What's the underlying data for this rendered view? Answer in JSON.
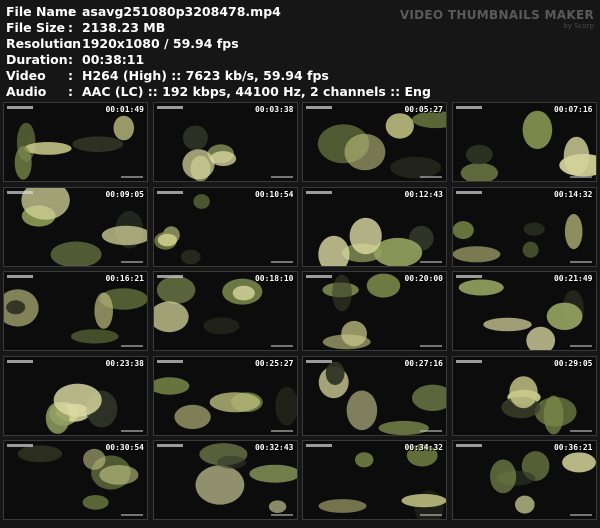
{
  "file_info": [
    {
      "label": "File Name",
      "value": "asavg251080p3208478.mp4"
    },
    {
      "label": "File Size",
      "value": "2138.23 MB"
    },
    {
      "label": "Resolution",
      "value": "1920x1080 / 59.94 fps"
    },
    {
      "label": "Duration",
      "value": "00:38:11"
    },
    {
      "label": "Video",
      "value": "H264 (High) :: 7623 kb/s, 59.94 fps"
    },
    {
      "label": "Audio",
      "value": "AAC (LC) :: 192 kbps, 44100 Hz, 2 channels :: Eng"
    }
  ],
  "separator": ":",
  "brand": {
    "title": "VIDEO THUMBNAILS MAKER",
    "subtitle": "by Scorp"
  },
  "thumbnails": [
    "00:01:49",
    "00:03:38",
    "00:05:27",
    "00:07:16",
    "00:09:05",
    "00:10:54",
    "00:12:43",
    "00:14:32",
    "00:16:21",
    "00:18:10",
    "00:20:00",
    "00:21:49",
    "00:23:38",
    "00:25:27",
    "00:27:16",
    "00:29:05",
    "00:30:54",
    "00:32:43",
    "00:34:32",
    "00:36:21"
  ],
  "colors": {
    "background": "#161616",
    "text": "#ffffff",
    "brand": "#5a5a5a",
    "thumb_border": "#3a3a3a"
  }
}
